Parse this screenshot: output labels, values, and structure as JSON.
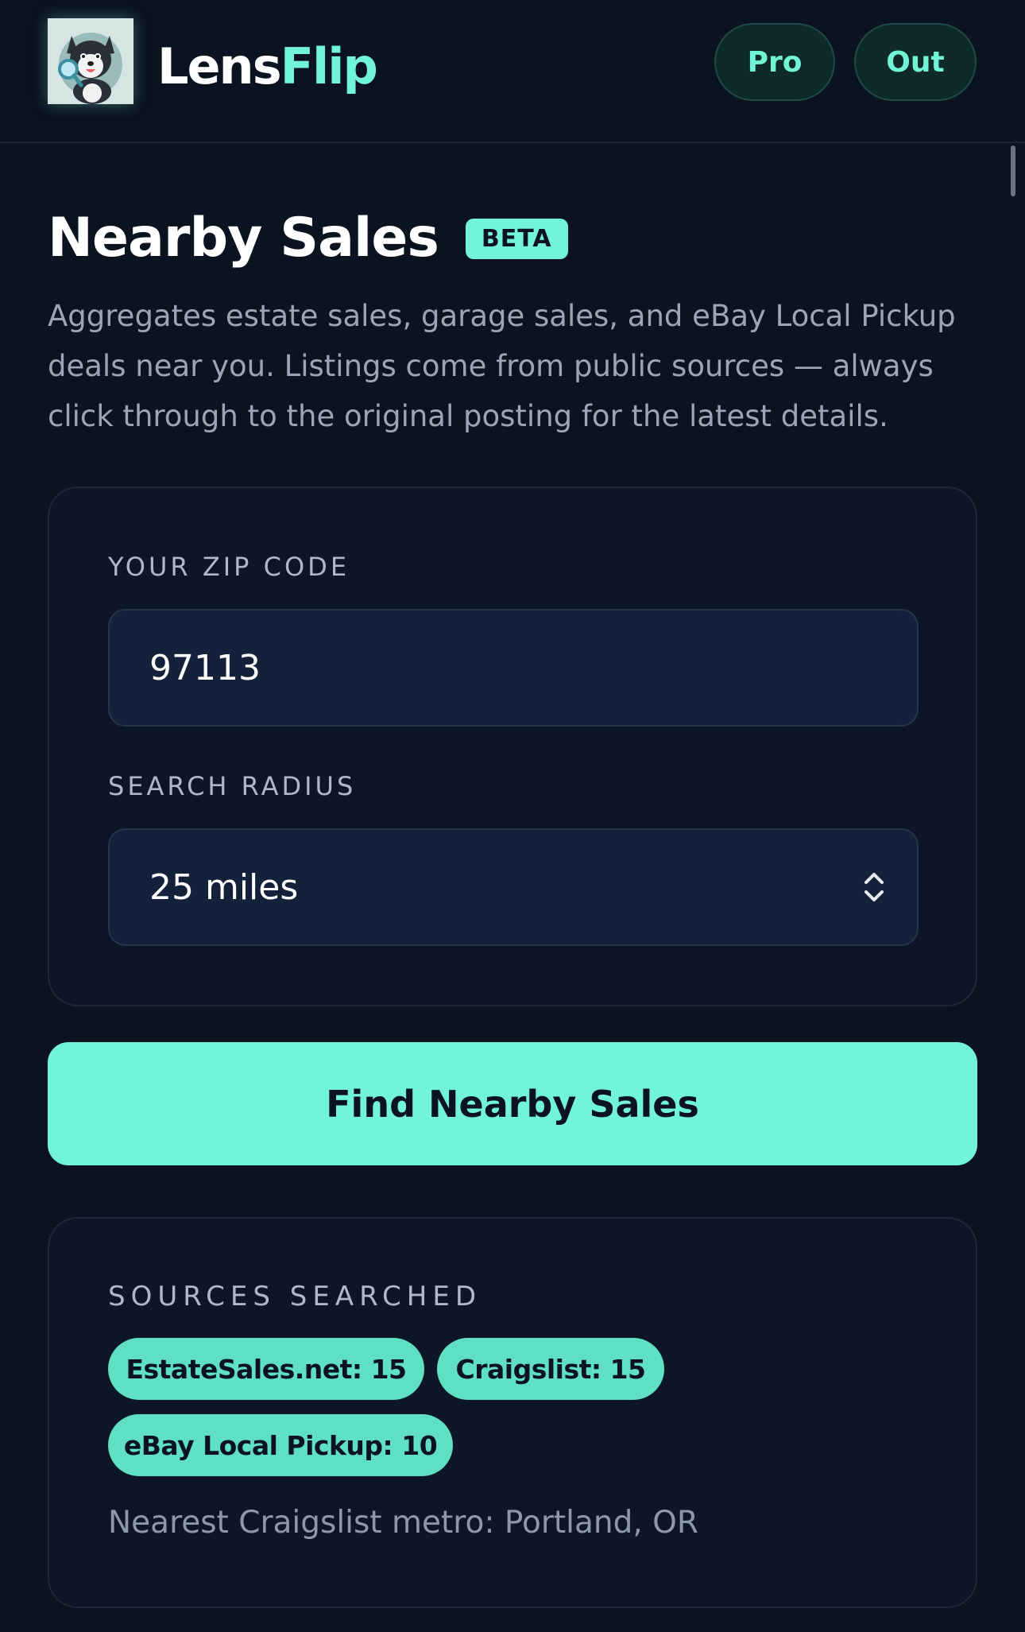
{
  "header": {
    "brand_part1": "Lens",
    "brand_part2": "Flip",
    "buttons": {
      "pro": "Pro",
      "out": "Out"
    }
  },
  "page": {
    "title": "Nearby Sales",
    "badge": "BETA",
    "description": "Aggregates estate sales, garage sales, and eBay Local Pickup deals near you. Listings come from public sources — always click through to the original posting for the latest details."
  },
  "form": {
    "zip_label": "YOUR ZIP CODE",
    "zip_value": "97113",
    "radius_label": "SEARCH RADIUS",
    "radius_value": "25 miles"
  },
  "action": {
    "find_label": "Find Nearby Sales"
  },
  "sources": {
    "label": "SOURCES SEARCHED",
    "chips": [
      "EstateSales.net: 15",
      "Craigslist: 15",
      "eBay Local Pickup: 10"
    ],
    "metro_note": "Nearest Craigslist metro: Portland, OR"
  },
  "colors": {
    "accent": "#72f5d7",
    "background": "#0b1220",
    "card": "#0d1626",
    "field": "#13213a"
  },
  "icons": {
    "logo": "husky-with-magnifier-logo",
    "select": "chevron-up-down-icon"
  }
}
